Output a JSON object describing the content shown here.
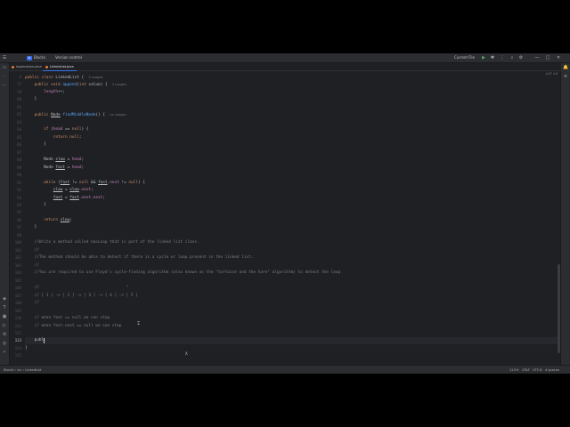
{
  "titlebar": {
    "project_badge": "B",
    "project": "Blocks",
    "branch": "Version control",
    "run_config": "Current File"
  },
  "tabs": [
    {
      "label": "Application.java",
      "active": false
    },
    {
      "label": "LinkedList.java",
      "active": true
    }
  ],
  "editor": {
    "inspection": "⚠17 ⚠3",
    "current_line": "113",
    "lines": [
      {
        "no": "8",
        "html": "<span class='kw'>public class</span> LinkedList {  <span class='hint'>3 usages</span>"
      },
      {
        "no": "71",
        "html": "    <span class='kw'>public void</span> <span class='fn'>append</span>(<span class='kw'>int</span> value) {  <span class='hint'>3 usages</span>"
      },
      {
        "no": "79",
        "html": "        <span class='fld'>length</span>++;"
      },
      {
        "no": "80",
        "html": "    }"
      },
      {
        "no": "81",
        "html": ""
      },
      {
        "no": "82",
        "html": "    <span class='kw'>public</span> <span class='ty'>Node</span> <span class='fn'>findMiddleNode</span>() {  <span class='hint'>no usages</span>"
      },
      {
        "no": "83",
        "html": ""
      },
      {
        "no": "84",
        "html": "        <span class='kw'>if</span> (<span class='fld'>head</span> == <span class='kw'>null</span>) {"
      },
      {
        "no": "85",
        "html": "            <span class='kw'>return null</span>;"
      },
      {
        "no": "86",
        "html": "        }"
      },
      {
        "no": "87",
        "html": ""
      },
      {
        "no": "88",
        "html": "        Node <span class='und'>slow</span> = <span class='fld'>head</span>;"
      },
      {
        "no": "89",
        "html": "        Node <span class='und'>fast</span> = <span class='fld'>head</span>;"
      },
      {
        "no": "90",
        "html": ""
      },
      {
        "no": "91",
        "html": "        <span class='kw'>while</span> (<span class='und'>fast</span> != <span class='kw'>null</span> &amp;&amp; <span class='und'>fast</span>.<span class='fld'>next</span> != <span class='kw'>null</span>) {"
      },
      {
        "no": "92",
        "html": "            <span class='und'>slow</span> = <span class='und'>slow</span>.<span class='fld'>next</span>;"
      },
      {
        "no": "93",
        "html": "            <span class='und'>fast</span> = <span class='und'>fast</span>.<span class='fld'>next</span>.<span class='fld'>next</span>;"
      },
      {
        "no": "94",
        "html": "        }"
      },
      {
        "no": "95",
        "html": ""
      },
      {
        "no": "96",
        "html": "        <span class='kw'>return</span> <span class='und'>slow</span>;"
      },
      {
        "no": "97",
        "html": "    }"
      },
      {
        "no": "98",
        "html": ""
      },
      {
        "no": "100",
        "html": "    <span class='cm'>//Write a method called hasLoop that is part of the linked list class.</span>"
      },
      {
        "no": "101",
        "html": "    <span class='cm'>//</span>"
      },
      {
        "no": "102",
        "html": "    <span class='cm'>//The method should be able to detect if there is a cycle or loop present in the linked list.</span>"
      },
      {
        "no": "103",
        "html": "    <span class='cm'>//</span>"
      },
      {
        "no": "104",
        "html": "    <span class='cm'>//You are required to use Floyd's cycle-finding algorithm (also known as the \"tortoise and the hare\" algorithm) to detect the loop</span>"
      },
      {
        "no": "105",
        "html": ""
      },
      {
        "no": "106",
        "html": "    <span class='cm'>//                                     ^</span>"
      },
      {
        "no": "107",
        "html": "    <span class='cm'>// [ 1 ] -&gt; [ 2 ] -&gt; [ 3 ] -&gt; [ 4 ] -&gt; [ 5 ]</span>"
      },
      {
        "no": "108",
        "html": "    <span class='cm'>//</span>"
      },
      {
        "no": "109",
        "html": ""
      },
      {
        "no": "110",
        "html": "    <span class='cm'>// when fast == null we can stop</span>"
      },
      {
        "no": "111",
        "html": "    <span class='cm'>// when fast.next == null we can stop</span>"
      },
      {
        "no": "112",
        "html": ""
      },
      {
        "no": "113",
        "html": "    publ"
      },
      {
        "no": "114",
        "html": "}"
      },
      {
        "no": "115",
        "html": ""
      }
    ],
    "stray_mark": "X"
  },
  "statusbar": {
    "path": "Blocks › src › LinkedList",
    "position": "113:9",
    "line_sep": "CRLF",
    "encoding": "UTF-8",
    "indent": "4 spaces"
  }
}
